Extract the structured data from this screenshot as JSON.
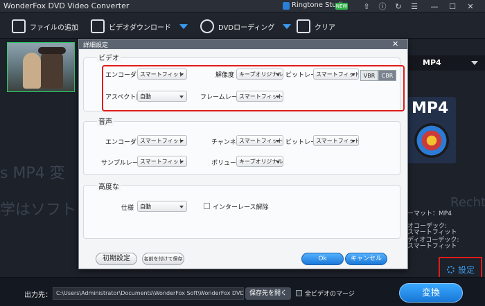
{
  "window": {
    "title": "WonderFox DVD Video Converter"
  },
  "titlebar": {
    "ringtone_label": "Ringtone Studio",
    "new_badge": "NEW"
  },
  "toolbar": {
    "add_files": "ファイルの追加",
    "video_download": "ビデオダウンロード",
    "dvd_loading": "DVDローディング",
    "clear": "クリア"
  },
  "background": {
    "left_text_1": "s MP4 変",
    "left_text_2": "学はソフト",
    "right_text": "Recht",
    "format_selected": "MP4",
    "art_label": "MP4",
    "info_lines": [
      "ーマット：MP4",
      "オコーデック:",
      "スマートフィット",
      "ディオコーデック:",
      "スマートフィット"
    ]
  },
  "settings_link": "設定",
  "bottom": {
    "output_label": "出力先：",
    "output_path": "C:\\Users\\Administrator\\Documents\\WonderFox Soft\\WonderFox DVD Vi...",
    "open_folder": "保存先を開く",
    "merge_label": "全ビデオのマージ",
    "convert": "変換"
  },
  "dialog": {
    "title": "詳細設定",
    "video": {
      "section": "ビデオ",
      "encoder_label": "エンコーダー",
      "encoder_value": "スマートフィット",
      "resolution_label": "解像度",
      "resolution_value": "キープオリジナル",
      "bitrate_label": "ビットレート",
      "bitrate_value": "スマートフィット",
      "vbr": "VBR",
      "cbr": "CBR",
      "aspect_label": "アスペクト比",
      "aspect_value": "自動",
      "framerate_label": "フレームレート",
      "framerate_value": "スマートフィット"
    },
    "audio": {
      "section": "音声",
      "encoder_label": "エンコーダー",
      "encoder_value": "スマートフィット",
      "channel_label": "チャンネル",
      "channel_value": "スマートフィット",
      "bitrate_label": "ビットレート",
      "bitrate_value": "スマートフィット",
      "samplerate_label": "サンプルレート",
      "samplerate_value": "スマートフィット",
      "volume_label": "ボリューム",
      "volume_value": "キープオリジナル"
    },
    "advanced": {
      "section": "高度な",
      "spec_label": "仕様",
      "spec_value": "自動",
      "deinterlace_label": "インターレース解除"
    },
    "buttons": {
      "init": "初期設定",
      "save_as": "名前を付けて保存",
      "ok": "Ok",
      "cancel": "キャンセル"
    }
  },
  "colors": {
    "accent_blue": "#3b9cf0",
    "highlight_red": "#e11b1b",
    "thumb_border": "#2bd16b"
  }
}
